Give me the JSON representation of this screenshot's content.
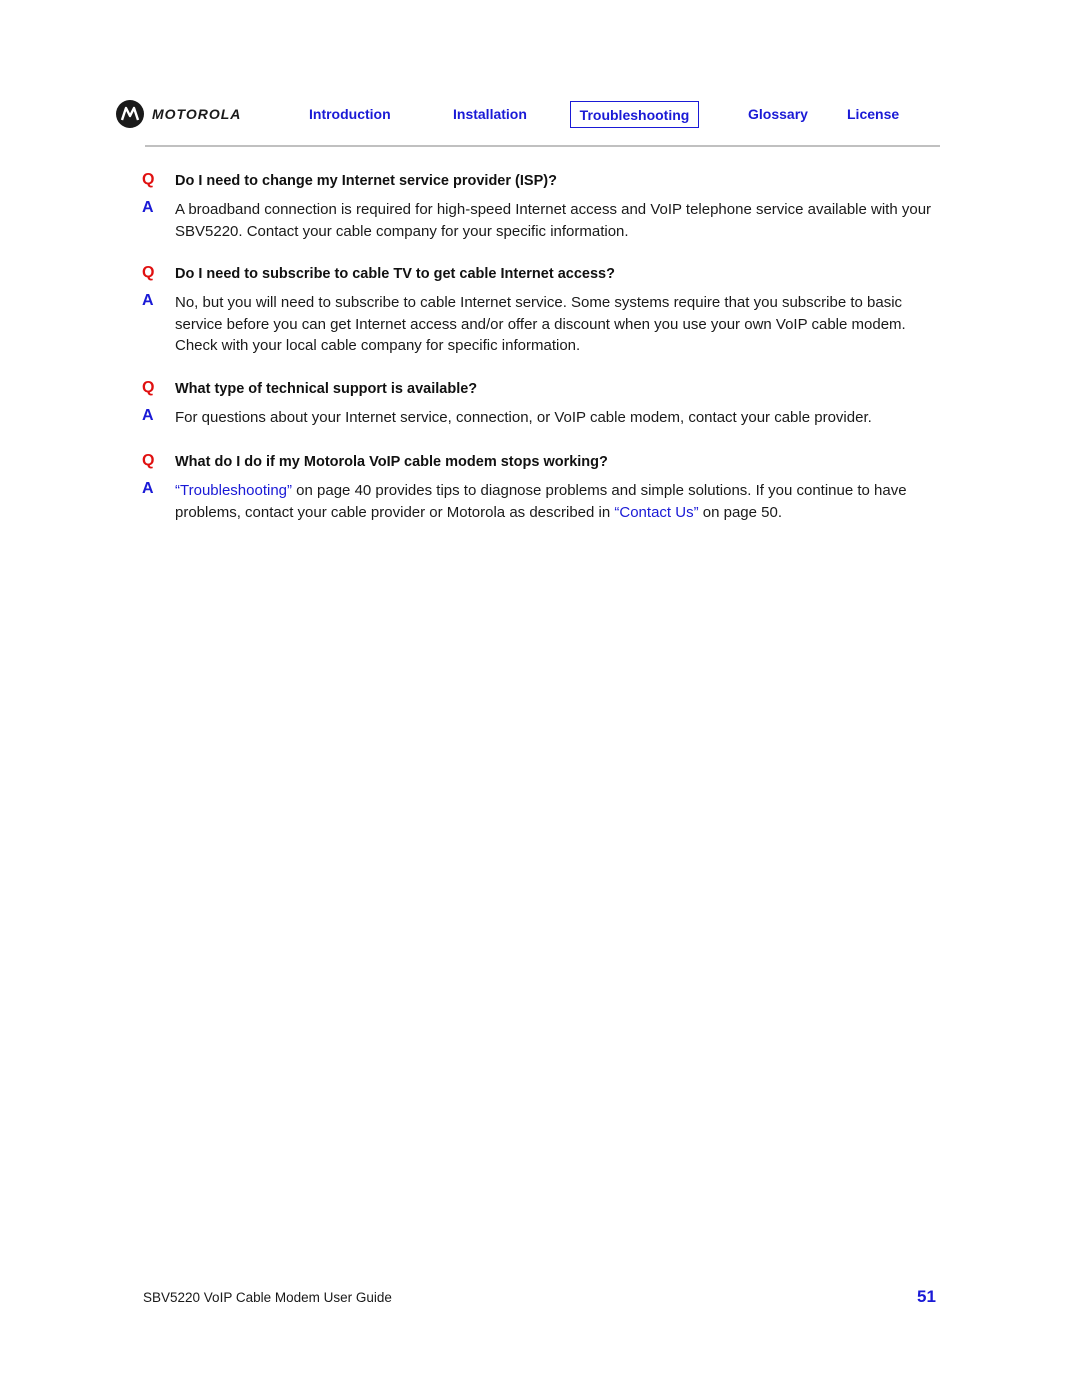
{
  "header": {
    "logo_text": "MOTOROLA",
    "nav": {
      "introduction": "Introduction",
      "installation": "Installation",
      "troubleshooting": "Troubleshooting",
      "glossary": "Glossary",
      "license": "License"
    },
    "active_tab": "Troubleshooting"
  },
  "markers": {
    "question": "Q",
    "answer": "A"
  },
  "faq": [
    {
      "question": "Do I need to change my Internet service provider (ISP)?",
      "answer": "A broadband connection is required for high-speed Internet access and VoIP telephone service available with your SBV5220. Contact your cable company for your specific information."
    },
    {
      "question": "Do I need to subscribe to cable TV to get cable Internet access?",
      "answer": "No, but you will need to subscribe to cable Internet service. Some systems require that you subscribe to basic service before you can get Internet access and/or offer a discount when you use your own VoIP cable modem. Check with your local cable company for specific information."
    },
    {
      "question": "What type of technical support is available?",
      "answer": "For questions about your Internet service, connection, or VoIP cable modem, contact your cable provider."
    },
    {
      "question": "What do I do if my Motorola VoIP cable modem stops working?",
      "answer_parts": {
        "link1": "“Troubleshooting”",
        "text1": " on page 40 provides tips to diagnose problems and simple solutions. If you continue to have problems, contact your cable provider or Motorola as described in ",
        "link2": "“Contact Us”",
        "text2": " on page 50."
      }
    }
  ],
  "footer": {
    "title": "SBV5220 VoIP Cable Modem User Guide",
    "page_number": "51"
  },
  "colors": {
    "link_blue": "#1a1ad6",
    "question_red": "#e01010",
    "rule_gray": "#c0c0c0"
  }
}
